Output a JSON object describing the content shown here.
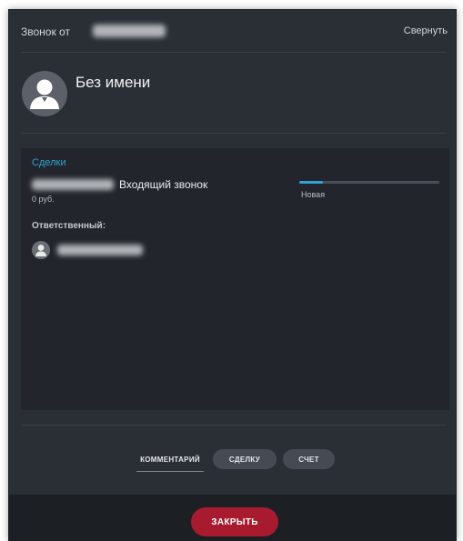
{
  "header": {
    "title": "Звонок от",
    "collapse_label": "Свернуть"
  },
  "contact": {
    "name": "Без имени",
    "avatar_icon": "user-icon"
  },
  "deals": {
    "section_title": "Сделки",
    "deal": {
      "title": "Входящий звонок",
      "amount": "0 руб.",
      "stage_label": "Новая",
      "stage_progress_fraction": 0.17
    },
    "responsible_label": "Ответственный:"
  },
  "tabs": [
    {
      "label": "КОММЕНТАРИЙ",
      "active": true
    },
    {
      "label": "СДЕЛКУ",
      "active": false
    },
    {
      "label": "СЧЕТ",
      "active": false
    }
  ],
  "footer": {
    "close_label": "ЗАКРЫТЬ"
  },
  "colors": {
    "background": "#2a2e35",
    "panel": "#22262c",
    "accent_blue": "#2fa2d8",
    "close_red": "#a81b2e"
  }
}
